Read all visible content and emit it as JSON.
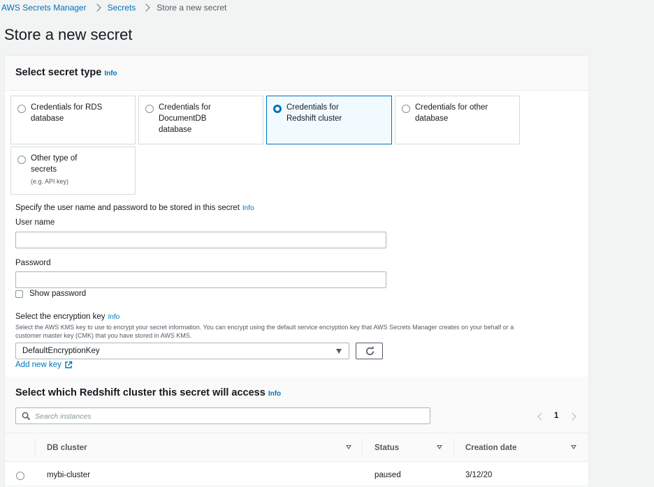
{
  "breadcrumb": {
    "items": [
      "AWS Secrets Manager",
      "Secrets"
    ],
    "current": "Store a new secret"
  },
  "page_title": "Store a new secret",
  "secret_type": {
    "heading": "Select secret type",
    "info": "Info",
    "options": [
      {
        "line1": "Credentials for RDS",
        "line2": "database",
        "line3": "",
        "selected": false
      },
      {
        "line1": "Credentials for",
        "line2": "DocumentDB",
        "line3": "database",
        "selected": false
      },
      {
        "line1": "Credentials for",
        "line2": "Redshift cluster",
        "line3": "",
        "selected": true
      },
      {
        "line1": "Credentials for other",
        "line2": "database",
        "line3": "",
        "selected": false
      },
      {
        "line1": "Other type of",
        "line2": "secrets",
        "sub": "(e.g. API key)",
        "selected": false
      }
    ]
  },
  "credentials": {
    "intro": "Specify the user name and password to be stored in this secret",
    "info": "Info",
    "username_label": "User name",
    "username_value": "",
    "password_label": "Password",
    "password_value": "",
    "show_password_label": "Show password",
    "show_password_checked": false
  },
  "encryption": {
    "label": "Select the encryption key",
    "info": "Info",
    "description_line1": "Select the AWS KMS key to use to encrypt your secret information. You can encrypt using the default service encryption key that AWS Secrets Manager creates on your behalf or a",
    "description_line2": "customer master key (CMK) that you have stored in AWS KMS.",
    "selected": "DefaultEncryptionKey",
    "add_key_link": "Add new key"
  },
  "cluster": {
    "heading": "Select which Redshift cluster this secret will access",
    "info": "Info",
    "search_placeholder": "Search instances",
    "page": "1",
    "columns": [
      "DB cluster",
      "Status",
      "Creation date"
    ],
    "rows": [
      {
        "name": "mybi-cluster",
        "status": "paused",
        "created": "3/12/20"
      }
    ]
  },
  "colors": {
    "link": "#0073bb",
    "selected_border": "#0073bb",
    "selected_bg": "#f1faff"
  }
}
